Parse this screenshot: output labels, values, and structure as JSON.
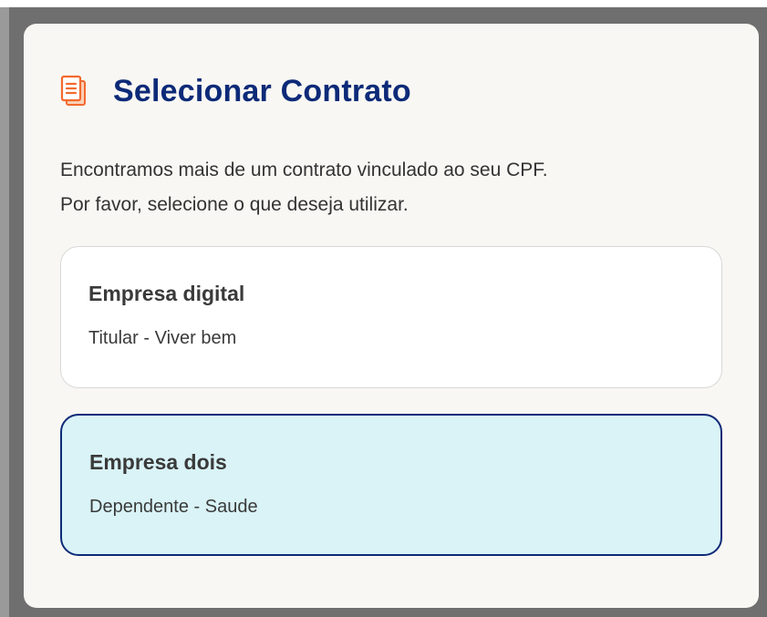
{
  "modal": {
    "title": "Selecionar Contrato",
    "title_icon": "document-icon",
    "description_line1": "Encontramos mais de um contrato vinculado ao seu CPF.",
    "description_line2": "Por favor, selecione o que deseja utilizar."
  },
  "contracts": [
    {
      "name": "Empresa digital",
      "detail": "Titular - Viver bem",
      "selected": false
    },
    {
      "name": "Empresa dois",
      "detail": "Dependente - Saude",
      "selected": true
    }
  ],
  "colors": {
    "title": "#0d2a78",
    "icon_accent": "#f26a2e",
    "modal_background": "#f8f7f3",
    "selected_background": "#d9f3f7",
    "selected_border": "#0d2a78",
    "overlay": "#6f6f6f"
  }
}
